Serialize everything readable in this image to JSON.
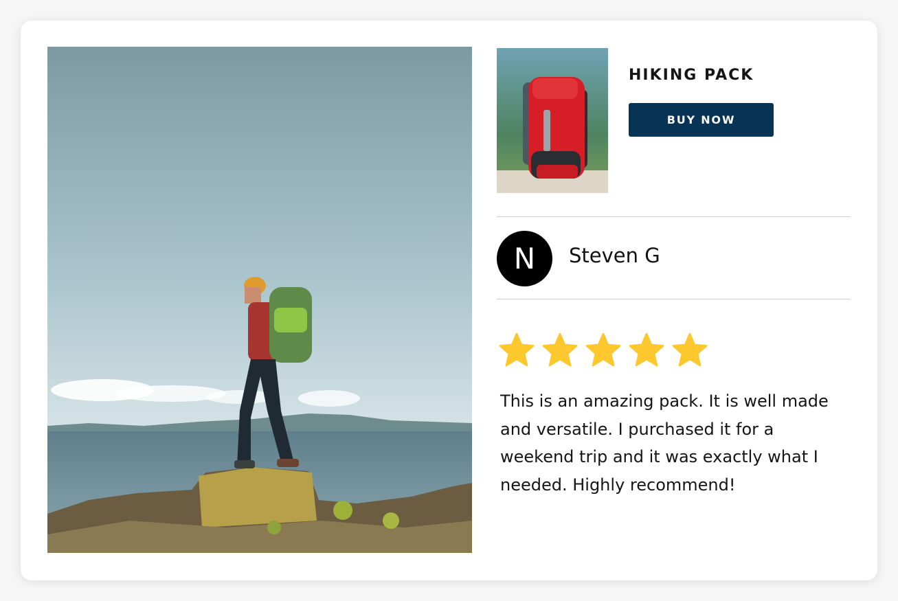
{
  "product": {
    "title": "HIKING PACK",
    "buy_label": "BUY NOW",
    "accent_color": "#073354"
  },
  "reviewer": {
    "initial": "N",
    "name": "Steven G"
  },
  "review": {
    "rating": 5,
    "rating_max": 5,
    "star_color": "#fdc82d",
    "text": "This is an amazing pack. It is well made and versatile. I purchased it for a weekend trip and it was exactly what I needed. Highly recommend!"
  },
  "images": {
    "hero": "hiker-on-coastal-rock-photo",
    "thumbnail": "red-hiking-backpack-photo"
  }
}
